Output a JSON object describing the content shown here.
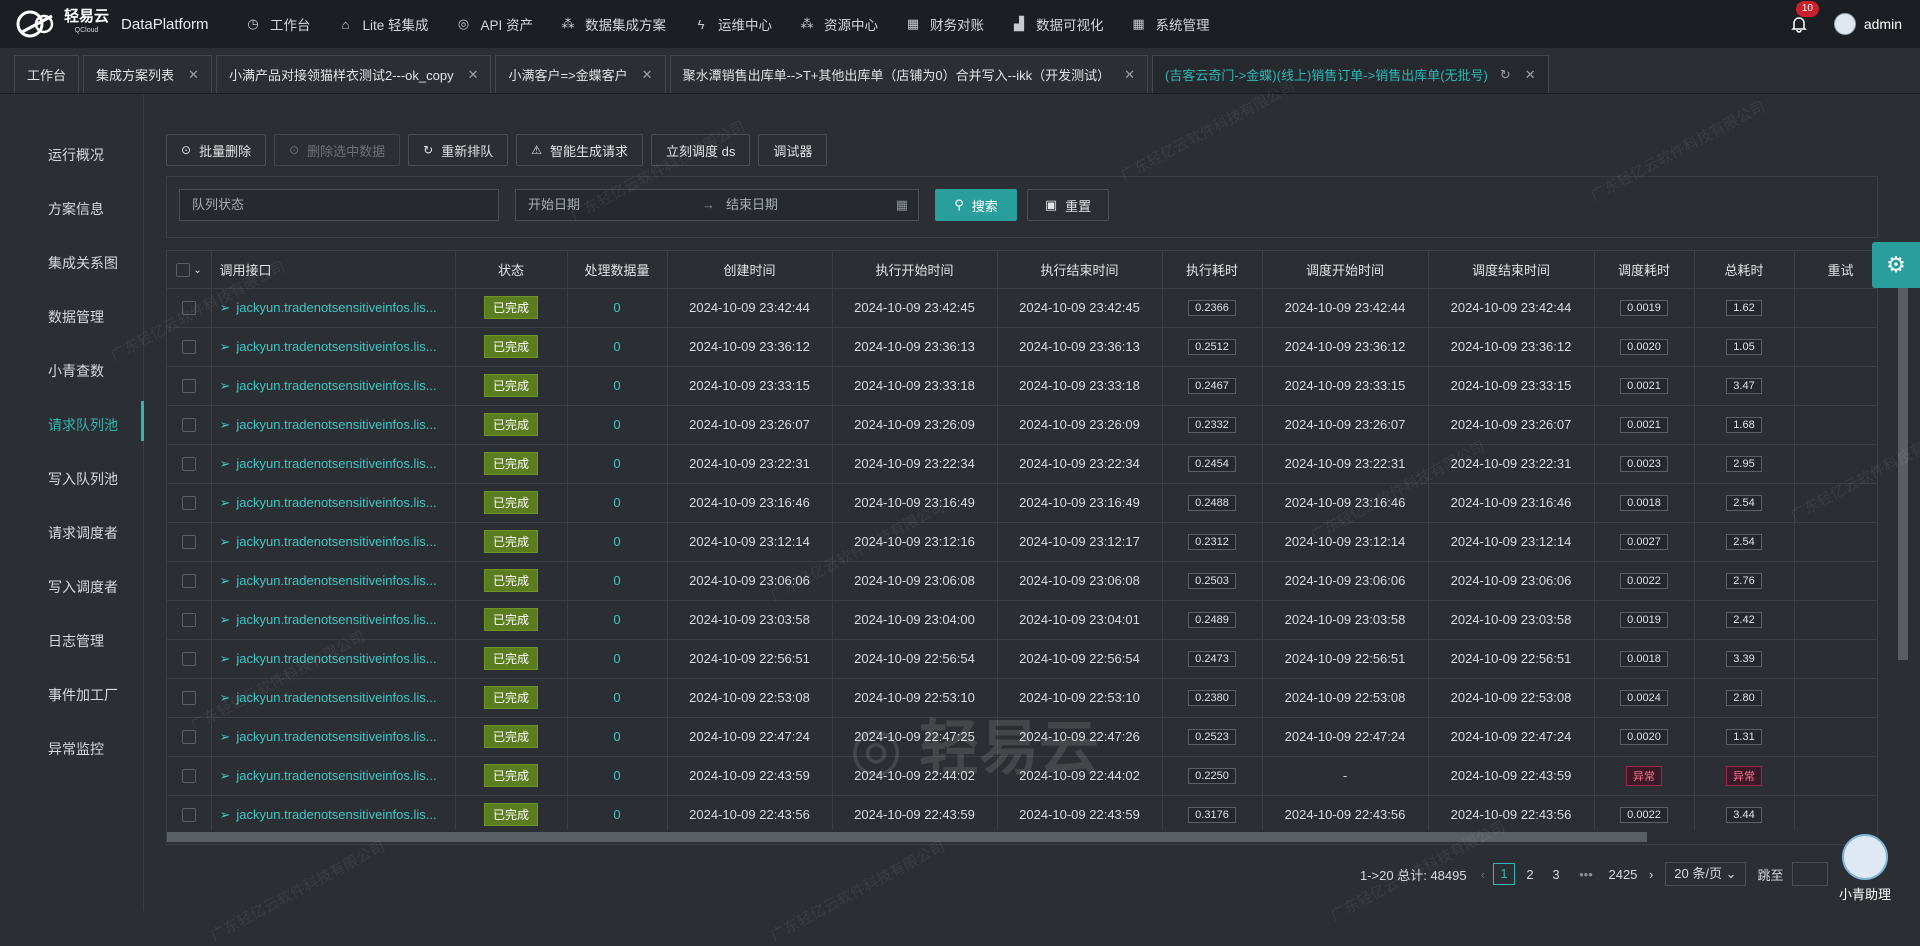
{
  "header": {
    "logo_text": "轻易云",
    "logo_sub": "QCloud",
    "brand": "DataPlatform",
    "menu": [
      {
        "label": "工作台",
        "icon": "clock-icon"
      },
      {
        "label": "Lite 轻集成",
        "icon": "tag-icon"
      },
      {
        "label": "API 资产",
        "icon": "compass-icon"
      },
      {
        "label": "数据集成方案",
        "icon": "nodes-icon"
      },
      {
        "label": "运维中心",
        "icon": "lightning-icon"
      },
      {
        "label": "资源中心",
        "icon": "nodes-icon"
      },
      {
        "label": "财务对账",
        "icon": "grid-icon"
      },
      {
        "label": "数据可视化",
        "icon": "chart-icon"
      },
      {
        "label": "系统管理",
        "icon": "grid-icon"
      }
    ],
    "notification_count": "10",
    "user": "admin"
  },
  "tabs": [
    {
      "label": "工作台",
      "closable": false
    },
    {
      "label": "集成方案列表",
      "closable": true
    },
    {
      "label": "小满产品对接领猫样衣测试2---ok_copy",
      "closable": true
    },
    {
      "label": "小满客户=>金蝶客户",
      "closable": true
    },
    {
      "label": "聚水潭销售出库单-->T+其他出库单（店铺为0）合并写入--ikk（开发测试）",
      "closable": true
    },
    {
      "label": "(吉客云奇门->金蝶)(线上)销售订单->销售出库单(无批号)",
      "closable": true,
      "active": true
    }
  ],
  "sidebar": [
    {
      "label": "运行概况"
    },
    {
      "label": "方案信息"
    },
    {
      "label": "集成关系图"
    },
    {
      "label": "数据管理"
    },
    {
      "label": "小青查数"
    },
    {
      "label": "请求队列池",
      "active": true
    },
    {
      "label": "写入队列池"
    },
    {
      "label": "请求调度者"
    },
    {
      "label": "写入调度者"
    },
    {
      "label": "日志管理"
    },
    {
      "label": "事件加工厂"
    },
    {
      "label": "异常监控"
    }
  ],
  "toolbar": {
    "batch_delete": "批量删除",
    "delete_selected": "删除选中数据",
    "requeue": "重新排队",
    "smart_generate": "智能生成请求",
    "dispatch_now": "立刻调度 ds",
    "debugger": "调试器"
  },
  "filter": {
    "queue_status_placeholder": "队列状态",
    "start_date": "开始日期",
    "end_date": "结束日期",
    "search": "搜索",
    "reset": "重置"
  },
  "table": {
    "columns": [
      "调用接口",
      "状态",
      "处理数据量",
      "创建时间",
      "执行开始时间",
      "执行结束时间",
      "执行耗时",
      "调度开始时间",
      "调度结束时间",
      "调度耗时",
      "总耗时",
      "重试"
    ],
    "rows": [
      {
        "api": "jackyun.tradenotsensitiveinfos.lis...",
        "status": "已完成",
        "count": "0",
        "created": "2024-10-09 23:42:44",
        "exec_start": "2024-10-09 23:42:45",
        "exec_end": "2024-10-09 23:42:45",
        "exec_cost": "0.2366",
        "sched_start": "2024-10-09 23:42:44",
        "sched_end": "2024-10-09 23:42:44",
        "sched_cost": "0.0019",
        "total": "1.62"
      },
      {
        "api": "jackyun.tradenotsensitiveinfos.lis...",
        "status": "已完成",
        "count": "0",
        "created": "2024-10-09 23:36:12",
        "exec_start": "2024-10-09 23:36:13",
        "exec_end": "2024-10-09 23:36:13",
        "exec_cost": "0.2512",
        "sched_start": "2024-10-09 23:36:12",
        "sched_end": "2024-10-09 23:36:12",
        "sched_cost": "0.0020",
        "total": "1.05"
      },
      {
        "api": "jackyun.tradenotsensitiveinfos.lis...",
        "status": "已完成",
        "count": "0",
        "created": "2024-10-09 23:33:15",
        "exec_start": "2024-10-09 23:33:18",
        "exec_end": "2024-10-09 23:33:18",
        "exec_cost": "0.2467",
        "sched_start": "2024-10-09 23:33:15",
        "sched_end": "2024-10-09 23:33:15",
        "sched_cost": "0.0021",
        "total": "3.47"
      },
      {
        "api": "jackyun.tradenotsensitiveinfos.lis...",
        "status": "已完成",
        "count": "0",
        "created": "2024-10-09 23:26:07",
        "exec_start": "2024-10-09 23:26:09",
        "exec_end": "2024-10-09 23:26:09",
        "exec_cost": "0.2332",
        "sched_start": "2024-10-09 23:26:07",
        "sched_end": "2024-10-09 23:26:07",
        "sched_cost": "0.0021",
        "total": "1.68"
      },
      {
        "api": "jackyun.tradenotsensitiveinfos.lis...",
        "status": "已完成",
        "count": "0",
        "created": "2024-10-09 23:22:31",
        "exec_start": "2024-10-09 23:22:34",
        "exec_end": "2024-10-09 23:22:34",
        "exec_cost": "0.2454",
        "sched_start": "2024-10-09 23:22:31",
        "sched_end": "2024-10-09 23:22:31",
        "sched_cost": "0.0023",
        "total": "2.95"
      },
      {
        "api": "jackyun.tradenotsensitiveinfos.lis...",
        "status": "已完成",
        "count": "0",
        "created": "2024-10-09 23:16:46",
        "exec_start": "2024-10-09 23:16:49",
        "exec_end": "2024-10-09 23:16:49",
        "exec_cost": "0.2488",
        "sched_start": "2024-10-09 23:16:46",
        "sched_end": "2024-10-09 23:16:46",
        "sched_cost": "0.0018",
        "total": "2.54"
      },
      {
        "api": "jackyun.tradenotsensitiveinfos.lis...",
        "status": "已完成",
        "count": "0",
        "created": "2024-10-09 23:12:14",
        "exec_start": "2024-10-09 23:12:16",
        "exec_end": "2024-10-09 23:12:17",
        "exec_cost": "0.2312",
        "sched_start": "2024-10-09 23:12:14",
        "sched_end": "2024-10-09 23:12:14",
        "sched_cost": "0.0027",
        "total": "2.54"
      },
      {
        "api": "jackyun.tradenotsensitiveinfos.lis...",
        "status": "已完成",
        "count": "0",
        "created": "2024-10-09 23:06:06",
        "exec_start": "2024-10-09 23:06:08",
        "exec_end": "2024-10-09 23:06:08",
        "exec_cost": "0.2503",
        "sched_start": "2024-10-09 23:06:06",
        "sched_end": "2024-10-09 23:06:06",
        "sched_cost": "0.0022",
        "total": "2.76"
      },
      {
        "api": "jackyun.tradenotsensitiveinfos.lis...",
        "status": "已完成",
        "count": "0",
        "created": "2024-10-09 23:03:58",
        "exec_start": "2024-10-09 23:04:00",
        "exec_end": "2024-10-09 23:04:01",
        "exec_cost": "0.2489",
        "sched_start": "2024-10-09 23:03:58",
        "sched_end": "2024-10-09 23:03:58",
        "sched_cost": "0.0019",
        "total": "2.42"
      },
      {
        "api": "jackyun.tradenotsensitiveinfos.lis...",
        "status": "已完成",
        "count": "0",
        "created": "2024-10-09 22:56:51",
        "exec_start": "2024-10-09 22:56:54",
        "exec_end": "2024-10-09 22:56:54",
        "exec_cost": "0.2473",
        "sched_start": "2024-10-09 22:56:51",
        "sched_end": "2024-10-09 22:56:51",
        "sched_cost": "0.0018",
        "total": "3.39"
      },
      {
        "api": "jackyun.tradenotsensitiveinfos.lis...",
        "status": "已完成",
        "count": "0",
        "created": "2024-10-09 22:53:08",
        "exec_start": "2024-10-09 22:53:10",
        "exec_end": "2024-10-09 22:53:10",
        "exec_cost": "0.2380",
        "sched_start": "2024-10-09 22:53:08",
        "sched_end": "2024-10-09 22:53:08",
        "sched_cost": "0.0024",
        "total": "2.80"
      },
      {
        "api": "jackyun.tradenotsensitiveinfos.lis...",
        "status": "已完成",
        "count": "0",
        "created": "2024-10-09 22:47:24",
        "exec_start": "2024-10-09 22:47:25",
        "exec_end": "2024-10-09 22:47:26",
        "exec_cost": "0.2523",
        "sched_start": "2024-10-09 22:47:24",
        "sched_end": "2024-10-09 22:47:24",
        "sched_cost": "0.0020",
        "total": "1.31"
      },
      {
        "api": "jackyun.tradenotsensitiveinfos.lis...",
        "status": "已完成",
        "count": "0",
        "created": "2024-10-09 22:43:59",
        "exec_start": "2024-10-09 22:44:02",
        "exec_end": "2024-10-09 22:44:02",
        "exec_cost": "0.2250",
        "sched_start": "-",
        "sched_end": "2024-10-09 22:43:59",
        "sched_cost": "异常",
        "total": "异常",
        "error": true
      },
      {
        "api": "jackyun.tradenotsensitiveinfos.lis...",
        "status": "已完成",
        "count": "0",
        "created": "2024-10-09 22:43:56",
        "exec_start": "2024-10-09 22:43:59",
        "exec_end": "2024-10-09 22:43:59",
        "exec_cost": "0.3176",
        "sched_start": "2024-10-09 22:43:56",
        "sched_end": "2024-10-09 22:43:56",
        "sched_cost": "0.0022",
        "total": "3.44"
      }
    ]
  },
  "pagination": {
    "summary": "1->20 总计: 48495",
    "pages": [
      "1",
      "2",
      "3"
    ],
    "ellipsis": "•••",
    "last_page": "2425",
    "page_size": "20 条/页",
    "goto_label": "跳至"
  },
  "assistant": {
    "label": "小青助理"
  },
  "watermark": "广东轻亿云软件科技有限公司",
  "colors": {
    "accent": "#2fb6b6",
    "status_done": "#5b7d1f",
    "error": "#a0234b"
  }
}
